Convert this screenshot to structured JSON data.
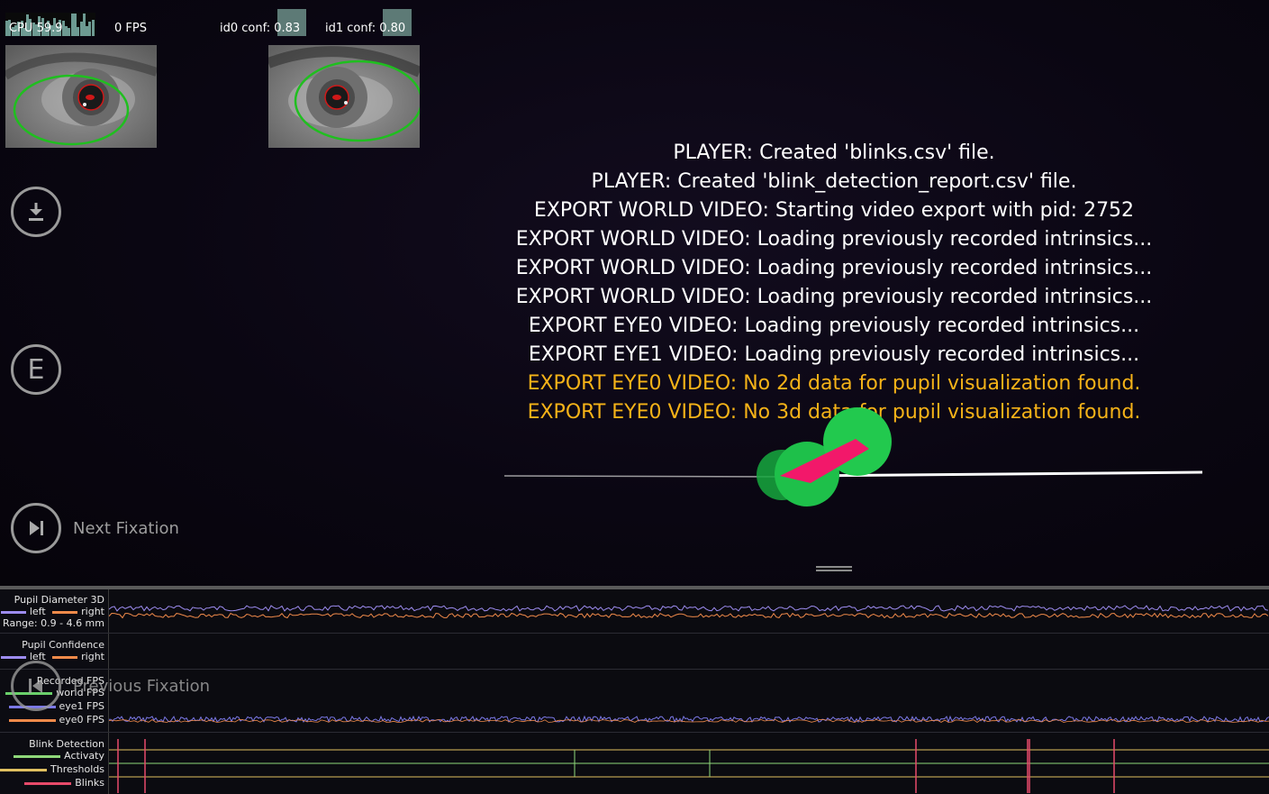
{
  "hud": {
    "cpu_label": "CPU 59.9",
    "fps_label": "0 FPS",
    "eye0_conf": "id0 conf: 0.83",
    "eye1_conf": "id1 conf: 0.80"
  },
  "buttons": {
    "export_icon": "download-icon",
    "annotation_letter": "E",
    "next_fixation": "Next Fixation",
    "previous_fixation": "Previous Fixation"
  },
  "log": [
    {
      "text": "PLAYER: Created 'blinks.csv' file.",
      "level": "info"
    },
    {
      "text": "PLAYER: Created 'blink_detection_report.csv' file.",
      "level": "info"
    },
    {
      "text": "EXPORT WORLD VIDEO: Starting video export with pid: 2752",
      "level": "info"
    },
    {
      "text": "EXPORT WORLD VIDEO: Loading previously recorded intrinsics...",
      "level": "info"
    },
    {
      "text": "EXPORT WORLD VIDEO: Loading previously recorded intrinsics...",
      "level": "info"
    },
    {
      "text": "EXPORT WORLD VIDEO: Loading previously recorded intrinsics...",
      "level": "info"
    },
    {
      "text": "EXPORT EYE0 VIDEO: Loading previously recorded intrinsics...",
      "level": "info"
    },
    {
      "text": "EXPORT EYE1 VIDEO: Loading previously recorded intrinsics...",
      "level": "info"
    },
    {
      "text": "EXPORT EYE0 VIDEO: No 2d data for pupil visualization found.",
      "level": "warning"
    },
    {
      "text": "EXPORT EYE0 VIDEO: No 3d data for pupil visualization found.",
      "level": "warning"
    }
  ],
  "timeline": {
    "pupil_diameter": {
      "title": "Pupil Diameter 3D",
      "left": "left",
      "right": "right",
      "range": "Range: 0.9 - 4.6 mm"
    },
    "pupil_confidence": {
      "title": "Pupil Confidence",
      "left": "left",
      "right": "right"
    },
    "fps": {
      "title": "Recorded FPS",
      "world": "world FPS",
      "eye1": "eye1 FPS",
      "eye0": "eye0 FPS"
    },
    "blink": {
      "title": "Blink Detection",
      "activity": "Activaty",
      "thresholds": "Thresholds",
      "blinks": "Blinks"
    }
  },
  "colors": {
    "left": "#9d8cf0",
    "right": "#f08a4a",
    "world_fps": "#6ad06a",
    "eye1_fps": "#7b78e6",
    "eye0_fps": "#f08a4a",
    "activity": "#8fd87a",
    "thresholds": "#e0c060",
    "blinks": "#e84a6a",
    "warning": "#f6b318"
  }
}
